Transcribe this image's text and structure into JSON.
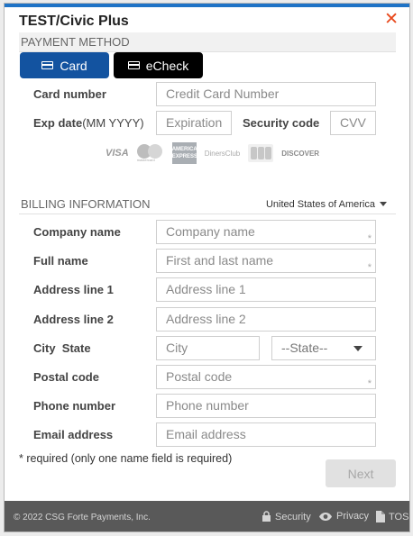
{
  "window": {
    "title": "TEST/Civic Plus",
    "close_symbol": "✕"
  },
  "payment": {
    "section_label": "PAYMENT METHOD",
    "tabs": [
      {
        "label": "Card",
        "icon": "card-icon"
      },
      {
        "label": "eCheck",
        "icon": "check-icon"
      }
    ],
    "card_number": {
      "label": "Card number",
      "placeholder": "Credit Card Number"
    },
    "exp": {
      "label": "Exp date",
      "label_hint": "(MM YYYY)",
      "placeholder": "Expiration"
    },
    "security": {
      "label": "Security code",
      "placeholder": "CVV"
    },
    "logos": {
      "visa": "VISA",
      "mastercard": "mastercard",
      "amex": "AMERICAN EXPRESS",
      "diners": "DinersClub",
      "discover": "DISCOVER"
    }
  },
  "billing": {
    "section_label": "BILLING INFORMATION",
    "country": "United States of America",
    "fields": {
      "company": {
        "label": "Company name",
        "placeholder": "Company name",
        "required_mark": "*"
      },
      "full_name": {
        "label": "Full name",
        "placeholder": "First and last name",
        "required_mark": "*"
      },
      "address1": {
        "label": "Address line 1",
        "placeholder": "Address line 1"
      },
      "address2": {
        "label": "Address line 2",
        "placeholder": "Address line 2"
      },
      "city_label": "City",
      "state_label": "State",
      "city_placeholder": "City",
      "state_value": "--State--",
      "postal": {
        "label": "Postal code",
        "placeholder": "Postal code",
        "required_mark": "*"
      },
      "phone": {
        "label": "Phone number",
        "placeholder": "Phone number"
      },
      "email": {
        "label": "Email address",
        "placeholder": "Email address"
      }
    }
  },
  "required_note": "* required   (only one name field is required)",
  "next_button": "Next",
  "footer": {
    "copyright": "© 2022 CSG Forte Payments, Inc.",
    "links": [
      {
        "label": "Security",
        "icon": "lock-icon"
      },
      {
        "label": "Privacy",
        "icon": "eye-icon"
      },
      {
        "label": "TOS",
        "icon": "document-icon"
      }
    ]
  },
  "colors": {
    "accent_bar": "#1f73c6",
    "card_tab": "#1353a0",
    "echeck_tab": "#000000",
    "close": "#e8491d",
    "footer": "#595959"
  }
}
